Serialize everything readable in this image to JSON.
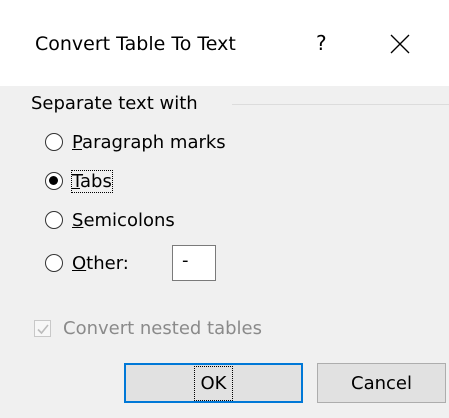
{
  "dialog": {
    "title": "Convert Table To Text",
    "help_label": "?",
    "close_icon": "close-icon"
  },
  "separate": {
    "group_label": "Separate text with",
    "options": [
      {
        "accel": "P",
        "rest": "aragraph marks",
        "checked": false
      },
      {
        "accel": "T",
        "rest": "abs",
        "checked": true
      },
      {
        "accel": "S",
        "rest": "emicolons",
        "checked": false
      },
      {
        "accel": "O",
        "rest": "ther:",
        "checked": false
      }
    ],
    "other_value": "-"
  },
  "nested": {
    "label": "Convert nested tables",
    "checked": true,
    "enabled": false
  },
  "buttons": {
    "ok_label": "OK",
    "cancel_label": "Cancel"
  },
  "colors": {
    "accent": "#0078d7",
    "client_bg": "#f0f0f0",
    "disabled_text": "#8a8a8a"
  }
}
